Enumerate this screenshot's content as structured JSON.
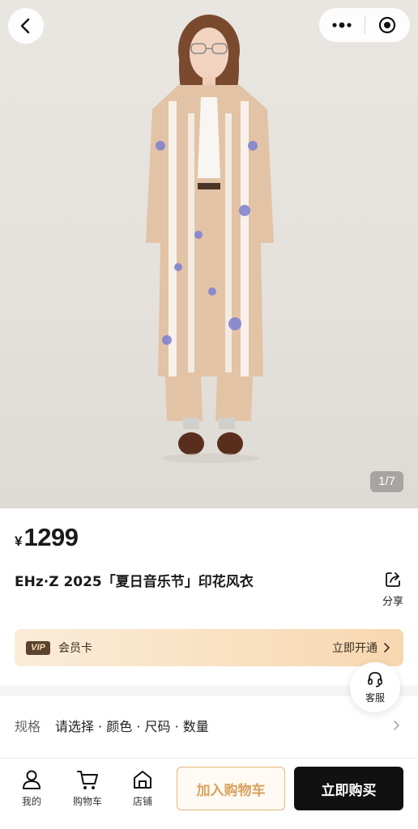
{
  "hero": {
    "pager": "1/7"
  },
  "product": {
    "currency": "¥",
    "price": "1299",
    "title": "EHz·Z 2025「夏日音乐节」印花风衣",
    "share_label": "分享"
  },
  "vip": {
    "badge": "VIP",
    "label": "会员卡",
    "action": "立即开通"
  },
  "customer_service": {
    "label": "客服"
  },
  "spec": {
    "key": "规格",
    "value": "请选择 · 颜色 · 尺码 · 数量"
  },
  "bottom_bar": {
    "nav": [
      {
        "label": "我的",
        "icon": "user-icon"
      },
      {
        "label": "购物车",
        "icon": "cart-icon"
      },
      {
        "label": "店铺",
        "icon": "store-icon"
      }
    ],
    "add_to_cart": "加入购物车",
    "buy_now": "立即购买"
  },
  "colors": {
    "accent": "#e8b77a",
    "buy": "#111111",
    "vip_bg": "#f9e1c2"
  }
}
